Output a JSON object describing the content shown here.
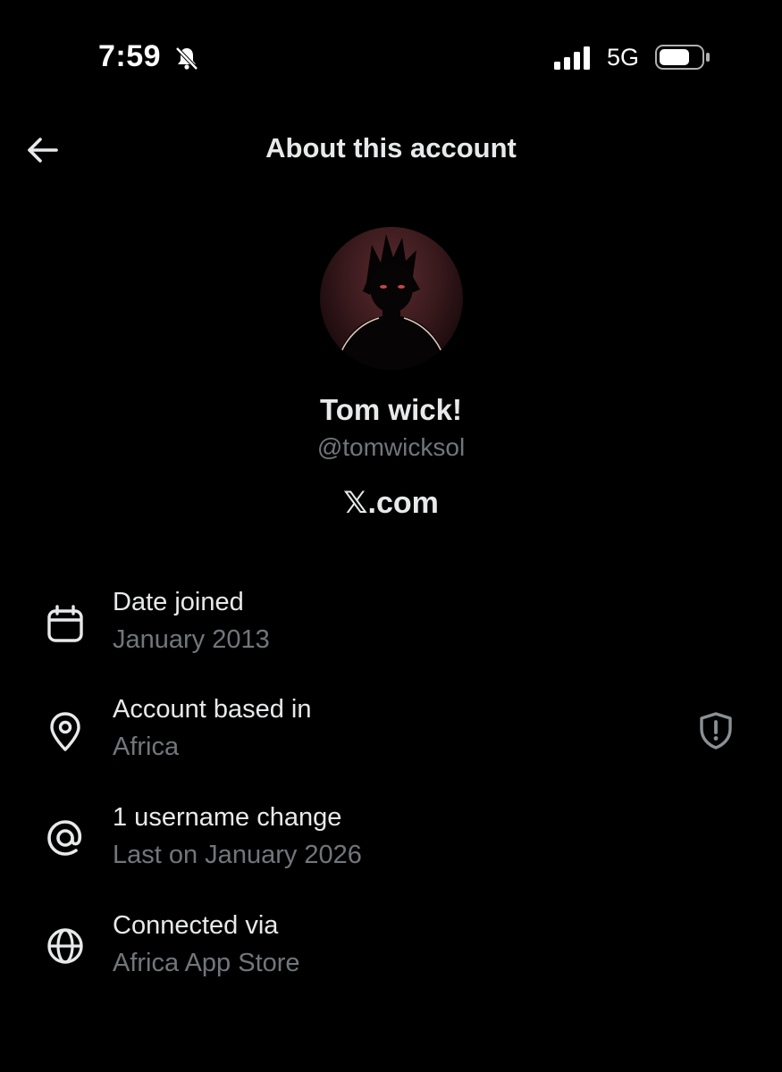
{
  "status_bar": {
    "time": "7:59",
    "network": "5G",
    "icons": [
      "bell-slash-icon",
      "signal-bars-icon",
      "battery-icon"
    ]
  },
  "header": {
    "title": "About this account",
    "back_icon": "arrow-left-icon"
  },
  "profile": {
    "display_name": "Tom wick!",
    "handle": "@tomwicksol",
    "platform": "𝕏.com"
  },
  "rows": [
    {
      "icon": "calendar-icon",
      "label": "Date joined",
      "value": "January 2013"
    },
    {
      "icon": "location-pin-icon",
      "label": "Account based in",
      "value": "Africa",
      "trailing_icon": "shield-exclamation-icon"
    },
    {
      "icon": "at-sign-icon",
      "label": "1 username change",
      "value": "Last on January 2026"
    },
    {
      "icon": "globe-icon",
      "label": "Connected via",
      "value": "Africa App Store"
    }
  ],
  "colors": {
    "background": "#000000",
    "primary_text": "#e7e9ea",
    "secondary_text": "#71767b"
  }
}
